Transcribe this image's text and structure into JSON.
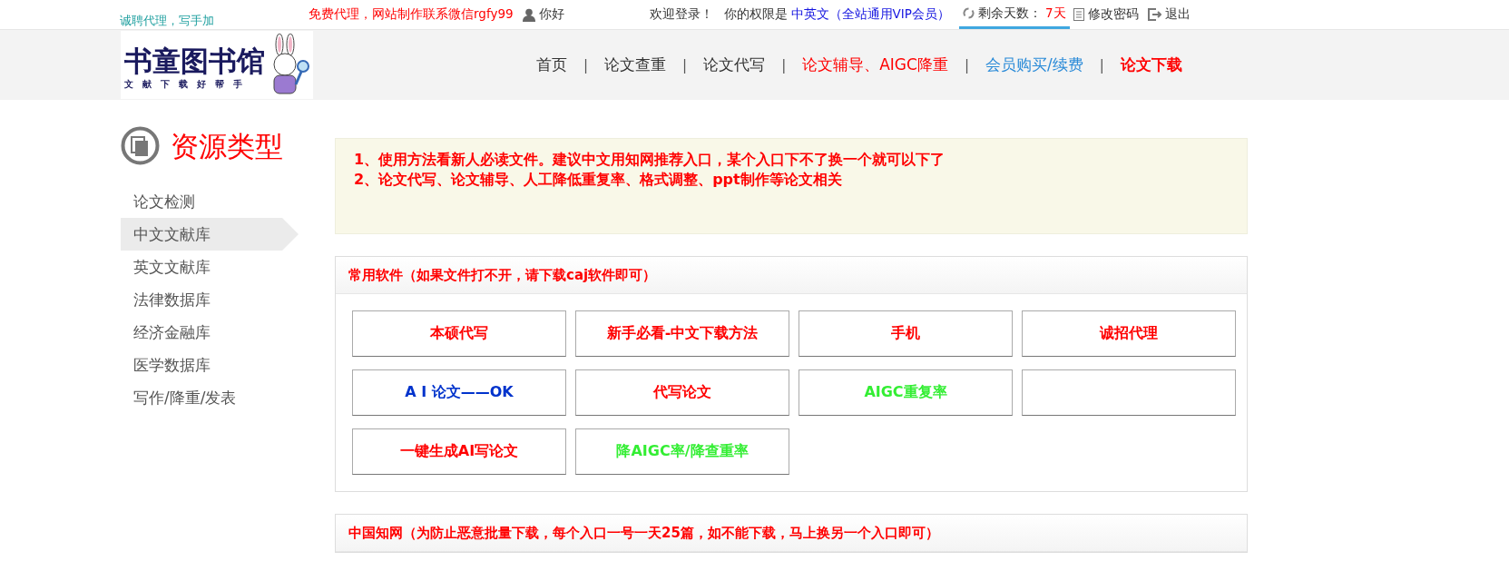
{
  "top_bar": {
    "promo_line": "诚聘代理，写手加",
    "notice": "免费代理，网站制作联系微信rgfy99",
    "greeting": "你好",
    "welcome": "欢迎登录！",
    "permission_label": "你的权限是",
    "permission_value": "中英文（全站通用VIP会员）",
    "days_label": "剩余天数：",
    "days_value": "7天",
    "change_password": "修改密码",
    "logout": "退出"
  },
  "logo": {
    "title": "书童图书馆",
    "subtitle": "文献下载好帮手"
  },
  "nav": [
    {
      "label": "首页",
      "kind": "normal"
    },
    {
      "label": "论文查重",
      "kind": "normal"
    },
    {
      "label": "论文代写",
      "kind": "normal"
    },
    {
      "label": "论文辅导、AIGC降重",
      "kind": "red"
    },
    {
      "label": "会员购买/续费",
      "kind": "blue"
    },
    {
      "label": "论文下载",
      "kind": "bold-red"
    }
  ],
  "nav_separators": [
    "|",
    "|",
    "|",
    "|",
    "|"
  ],
  "sidebar": {
    "title": "资源类型",
    "items": [
      {
        "label": "论文检测",
        "selected": false
      },
      {
        "label": "中文文献库",
        "selected": true
      },
      {
        "label": "英文文献库",
        "selected": false
      },
      {
        "label": "法律数据库",
        "selected": false
      },
      {
        "label": "经济金融库",
        "selected": false
      },
      {
        "label": "医学数据库",
        "selected": false
      },
      {
        "label": "写作/降重/发表",
        "selected": false
      }
    ]
  },
  "notice": [
    "1、使用方法看新人必读文件。建议中文用知网推荐入口，某个入口下不了换一个就可以下了",
    "2、论文代写、论文辅导、人工降低重复率、格式调整、ppt制作等论文相关"
  ],
  "software_panel": {
    "title": "常用软件（如果文件打不开，请下载caj软件即可）",
    "buttons": [
      {
        "kind": "text",
        "label": "本硕代写",
        "color": "#ff0000"
      },
      {
        "kind": "text",
        "label": "新手必看-中文下载方法",
        "color": "#ff0000"
      },
      {
        "kind": "text",
        "label": "手机",
        "color": "#ff0000"
      },
      {
        "kind": "text",
        "label": "诚招代理",
        "color": "#ff0000"
      },
      {
        "kind": "text",
        "label": "A I 论文——OK",
        "color": "#0033cc"
      },
      {
        "kind": "text",
        "label": "代写论文",
        "color": "#ff0000"
      },
      {
        "kind": "text",
        "label": "AIGC重复率",
        "color": "#33ee33"
      },
      {
        "kind": "blank"
      },
      {
        "kind": "text",
        "label": "一键生成AI写论文",
        "color": "#ff0000"
      },
      {
        "kind": "text",
        "label": "降AIGC率/降查重率",
        "color": "#33ee33"
      }
    ]
  },
  "cnki_panel": {
    "title": "中国知网（为防止恶意批量下载，每个入口一号一天25篇，如不能下载，马上换另一个入口即可）"
  }
}
